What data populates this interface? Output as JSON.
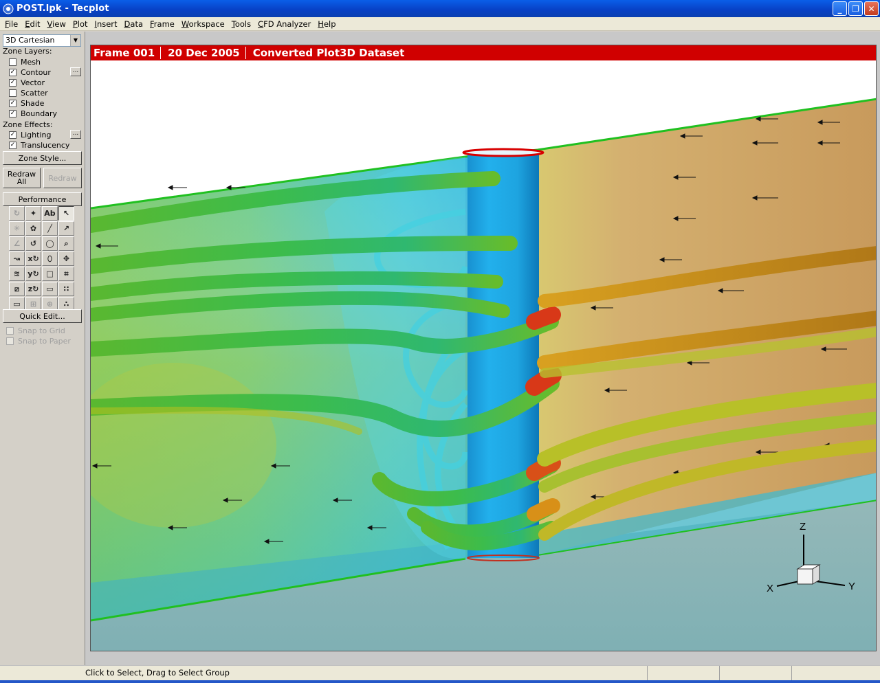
{
  "window": {
    "title": "POST.lpk - Tecplot",
    "controls": [
      "minimize",
      "maximize",
      "close"
    ]
  },
  "menu": [
    "File",
    "Edit",
    "View",
    "Plot",
    "Insert",
    "Data",
    "Frame",
    "Workspace",
    "Tools",
    "CFD Analyzer",
    "Help"
  ],
  "sidebar": {
    "plot_type": "3D Cartesian",
    "zone_layers_label": "Zone Layers:",
    "layers": [
      {
        "label": "Mesh",
        "checked": false
      },
      {
        "label": "Contour",
        "checked": true
      },
      {
        "label": "Vector",
        "checked": true
      },
      {
        "label": "Scatter",
        "checked": false
      },
      {
        "label": "Shade",
        "checked": true
      },
      {
        "label": "Boundary",
        "checked": true
      }
    ],
    "zone_effects_label": "Zone Effects:",
    "effects": [
      {
        "label": "Lighting",
        "checked": true
      },
      {
        "label": "Translucency",
        "checked": true
      }
    ],
    "dots_label": "...",
    "zone_style_button": "Zone Style...",
    "redraw_all_button": "Redraw All",
    "redraw_button": "Redraw",
    "performance_button": "Performance",
    "quick_edit_button": "Quick Edit...",
    "snap_to_grid": "Snap to Grid",
    "snap_to_paper": "Snap to Paper"
  },
  "frame": {
    "name": "Frame 001",
    "date": "20 Dec 2005",
    "dataset": "Converted Plot3D Dataset",
    "axes": {
      "x": "X",
      "y": "Y",
      "z": "Z"
    }
  },
  "status": {
    "text": "Click to Select, Drag to Select Group"
  },
  "colors": {
    "frame_header": "#d00000",
    "title_bar": "#0840c4",
    "cylinder": "#1aa0dc"
  }
}
